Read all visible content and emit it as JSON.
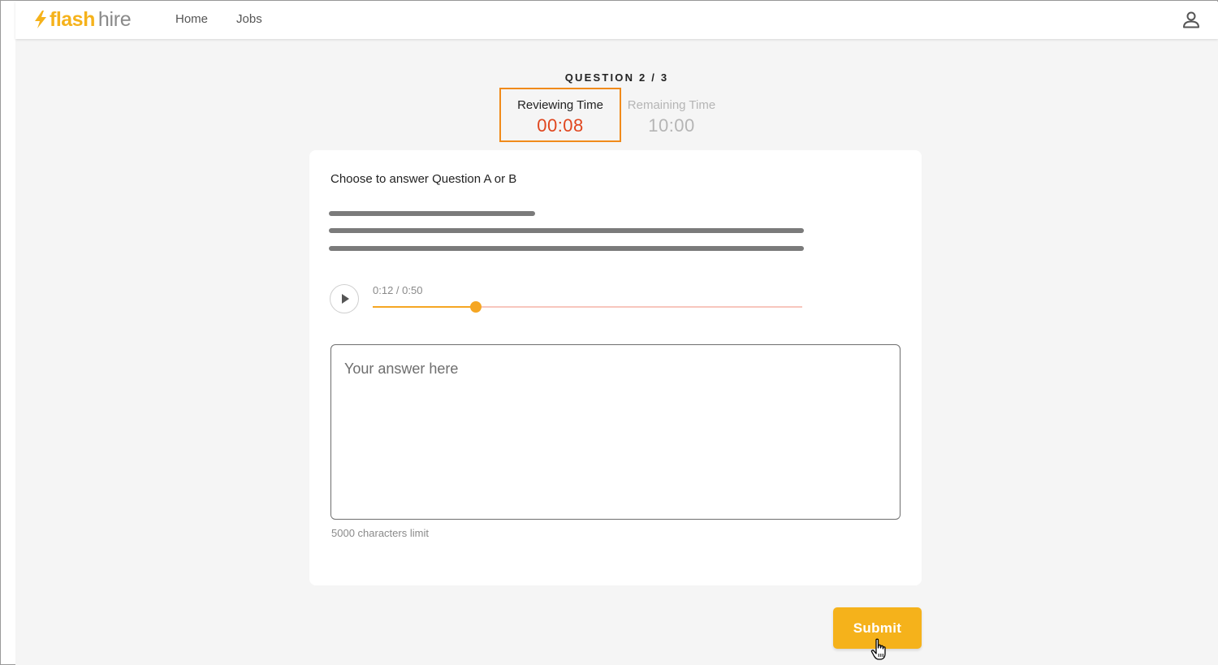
{
  "brand": {
    "name_bold": "flash",
    "name_light": "hire",
    "accent_color": "#f5b21b"
  },
  "nav": {
    "items": [
      {
        "label": "Home"
      },
      {
        "label": "Jobs"
      }
    ]
  },
  "question": {
    "counter": "QUESTION 2 / 3",
    "timers": {
      "reviewing": {
        "label": "Reviewing Time",
        "value": "00:08",
        "active": true,
        "value_color": "#e0461e"
      },
      "remaining": {
        "label": "Remaining Time",
        "value": "10:00",
        "active": false
      }
    },
    "prompt": "Choose to answer Question A or B",
    "audio": {
      "time_display": "0:12 / 0:50",
      "progress_fraction": 0.24
    },
    "answer": {
      "value": "",
      "placeholder": "Your answer here"
    },
    "char_limit": "5000 characters limit"
  },
  "actions": {
    "submit_label": "Submit"
  }
}
